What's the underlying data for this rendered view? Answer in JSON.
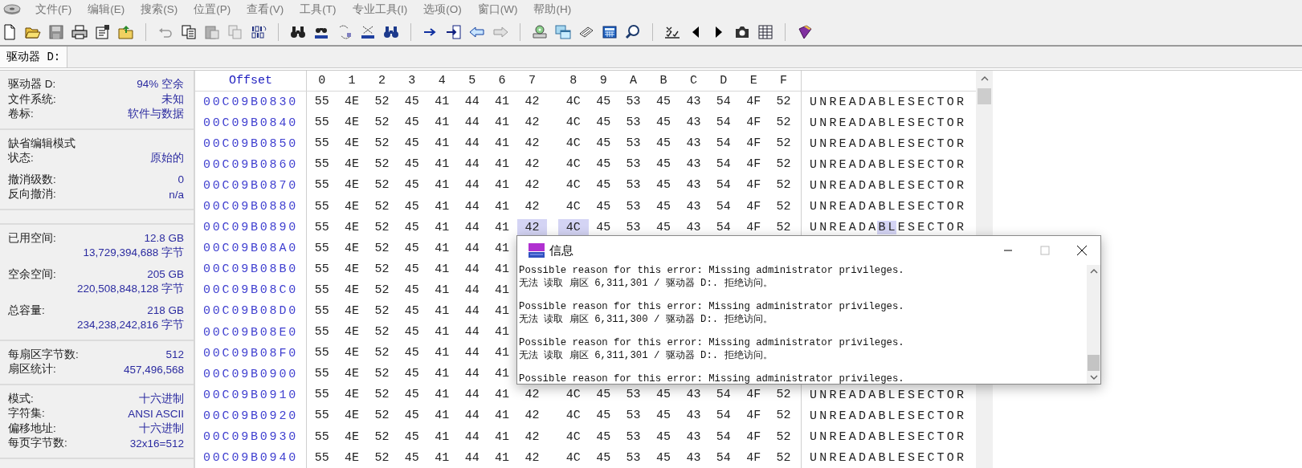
{
  "menu": [
    "文件(F)",
    "编辑(E)",
    "搜索(S)",
    "位置(P)",
    "查看(V)",
    "工具(T)",
    "专业工具(I)",
    "选项(O)",
    "窗口(W)",
    "帮助(H)"
  ],
  "tabs": [
    {
      "label": "驱动器 D:",
      "selected": true
    }
  ],
  "sidebar": {
    "sections": [
      {
        "groups": [
          [
            {
              "label": "驱动器 D:",
              "value": "94% 空余"
            },
            {
              "label": "文件系统:",
              "value": "未知"
            },
            {
              "label": "卷标:",
              "value": "软件与数据"
            }
          ]
        ]
      },
      {
        "groups": [
          [
            {
              "label": "缺省编辑模式"
            },
            {
              "label": "状态:",
              "value": "原始的"
            }
          ],
          [
            {
              "label": "撤消级数:",
              "value": "0"
            },
            {
              "label": "反向撤消:",
              "value": "n/a"
            }
          ]
        ],
        "blank_after": true
      },
      {
        "groups": [
          [
            {
              "label": "已用空间:",
              "value": "12.8 GB"
            },
            {
              "value": "13,729,394,688 字节"
            }
          ],
          [
            {
              "label": "空余空间:",
              "value": "205 GB"
            },
            {
              "value": "220,508,848,128 字节"
            }
          ],
          [
            {
              "label": "总容量:",
              "value": "218 GB"
            },
            {
              "value": "234,238,242,816 字节"
            }
          ]
        ]
      },
      {
        "groups": [
          [
            {
              "label": "每扇区字节数:",
              "value": "512"
            },
            {
              "label": "扇区统计:",
              "value": "457,496,568"
            }
          ]
        ]
      },
      {
        "groups": [
          [
            {
              "label": "模式:",
              "value": "十六进制"
            },
            {
              "label": "字符集:",
              "value": "ANSI ASCII"
            },
            {
              "label": "偏移地址:",
              "value": "十六进制"
            },
            {
              "label": "每页字节数:",
              "value": "32x16=512"
            }
          ]
        ]
      }
    ]
  },
  "hex": {
    "offset_header": "Offset",
    "columns": [
      "0",
      "1",
      "2",
      "3",
      "4",
      "5",
      "6",
      "7",
      "8",
      "9",
      "A",
      "B",
      "C",
      "D",
      "E",
      "F"
    ],
    "rows": [
      {
        "offset": "00C09B0830",
        "bytes": [
          {
            "hex": "55",
            "selected": false
          },
          {
            "hex": "4E",
            "selected": false
          },
          {
            "hex": "52",
            "selected": false
          },
          {
            "hex": "45",
            "selected": false
          },
          {
            "hex": "41",
            "selected": false
          },
          {
            "hex": "44",
            "selected": false
          },
          {
            "hex": "41",
            "selected": false
          },
          {
            "hex": "42",
            "selected": false
          },
          {
            "hex": "4C",
            "selected": false
          },
          {
            "hex": "45",
            "selected": false
          },
          {
            "hex": "53",
            "selected": false
          },
          {
            "hex": "45",
            "selected": false
          },
          {
            "hex": "43",
            "selected": false
          },
          {
            "hex": "54",
            "selected": false
          },
          {
            "hex": "4F",
            "selected": false
          },
          {
            "hex": "52",
            "selected": false
          }
        ],
        "ascii": "UNREADABLESECTOR"
      },
      {
        "offset": "00C09B0840",
        "bytes": [
          {
            "hex": "55",
            "selected": false
          },
          {
            "hex": "4E",
            "selected": false
          },
          {
            "hex": "52",
            "selected": false
          },
          {
            "hex": "45",
            "selected": false
          },
          {
            "hex": "41",
            "selected": false
          },
          {
            "hex": "44",
            "selected": false
          },
          {
            "hex": "41",
            "selected": false
          },
          {
            "hex": "42",
            "selected": false
          },
          {
            "hex": "4C",
            "selected": false
          },
          {
            "hex": "45",
            "selected": false
          },
          {
            "hex": "53",
            "selected": false
          },
          {
            "hex": "45",
            "selected": false
          },
          {
            "hex": "43",
            "selected": false
          },
          {
            "hex": "54",
            "selected": false
          },
          {
            "hex": "4F",
            "selected": false
          },
          {
            "hex": "52",
            "selected": false
          }
        ],
        "ascii": "UNREADABLESECTOR"
      },
      {
        "offset": "00C09B0850",
        "bytes": [
          {
            "hex": "55",
            "selected": false
          },
          {
            "hex": "4E",
            "selected": false
          },
          {
            "hex": "52",
            "selected": false
          },
          {
            "hex": "45",
            "selected": false
          },
          {
            "hex": "41",
            "selected": false
          },
          {
            "hex": "44",
            "selected": false
          },
          {
            "hex": "41",
            "selected": false
          },
          {
            "hex": "42",
            "selected": false
          },
          {
            "hex": "4C",
            "selected": false
          },
          {
            "hex": "45",
            "selected": false
          },
          {
            "hex": "53",
            "selected": false
          },
          {
            "hex": "45",
            "selected": false
          },
          {
            "hex": "43",
            "selected": false
          },
          {
            "hex": "54",
            "selected": false
          },
          {
            "hex": "4F",
            "selected": false
          },
          {
            "hex": "52",
            "selected": false
          }
        ],
        "ascii": "UNREADABLESECTOR"
      },
      {
        "offset": "00C09B0860",
        "bytes": [
          {
            "hex": "55",
            "selected": false
          },
          {
            "hex": "4E",
            "selected": false
          },
          {
            "hex": "52",
            "selected": false
          },
          {
            "hex": "45",
            "selected": false
          },
          {
            "hex": "41",
            "selected": false
          },
          {
            "hex": "44",
            "selected": false
          },
          {
            "hex": "41",
            "selected": false
          },
          {
            "hex": "42",
            "selected": false
          },
          {
            "hex": "4C",
            "selected": false
          },
          {
            "hex": "45",
            "selected": false
          },
          {
            "hex": "53",
            "selected": false
          },
          {
            "hex": "45",
            "selected": false
          },
          {
            "hex": "43",
            "selected": false
          },
          {
            "hex": "54",
            "selected": false
          },
          {
            "hex": "4F",
            "selected": false
          },
          {
            "hex": "52",
            "selected": false
          }
        ],
        "ascii": "UNREADABLESECTOR"
      },
      {
        "offset": "00C09B0870",
        "bytes": [
          {
            "hex": "55",
            "selected": false
          },
          {
            "hex": "4E",
            "selected": false
          },
          {
            "hex": "52",
            "selected": false
          },
          {
            "hex": "45",
            "selected": false
          },
          {
            "hex": "41",
            "selected": false
          },
          {
            "hex": "44",
            "selected": false
          },
          {
            "hex": "41",
            "selected": false
          },
          {
            "hex": "42",
            "selected": false
          },
          {
            "hex": "4C",
            "selected": false
          },
          {
            "hex": "45",
            "selected": false
          },
          {
            "hex": "53",
            "selected": false
          },
          {
            "hex": "45",
            "selected": false
          },
          {
            "hex": "43",
            "selected": false
          },
          {
            "hex": "54",
            "selected": false
          },
          {
            "hex": "4F",
            "selected": false
          },
          {
            "hex": "52",
            "selected": false
          }
        ],
        "ascii": "UNREADABLESECTOR"
      },
      {
        "offset": "00C09B0880",
        "bytes": [
          {
            "hex": "55",
            "selected": false
          },
          {
            "hex": "4E",
            "selected": false
          },
          {
            "hex": "52",
            "selected": false
          },
          {
            "hex": "45",
            "selected": false
          },
          {
            "hex": "41",
            "selected": false
          },
          {
            "hex": "44",
            "selected": false
          },
          {
            "hex": "41",
            "selected": false
          },
          {
            "hex": "42",
            "selected": false
          },
          {
            "hex": "4C",
            "selected": false
          },
          {
            "hex": "45",
            "selected": false
          },
          {
            "hex": "53",
            "selected": false
          },
          {
            "hex": "45",
            "selected": false
          },
          {
            "hex": "43",
            "selected": false
          },
          {
            "hex": "54",
            "selected": false
          },
          {
            "hex": "4F",
            "selected": false
          },
          {
            "hex": "52",
            "selected": false
          }
        ],
        "ascii": "UNREADABLESECTOR"
      },
      {
        "offset": "00C09B0890",
        "bytes": [
          {
            "hex": "55",
            "selected": false
          },
          {
            "hex": "4E",
            "selected": false
          },
          {
            "hex": "52",
            "selected": false
          },
          {
            "hex": "45",
            "selected": false
          },
          {
            "hex": "41",
            "selected": false
          },
          {
            "hex": "44",
            "selected": false
          },
          {
            "hex": "41",
            "selected": false
          },
          {
            "hex": "42",
            "selected": true
          },
          {
            "hex": "4C",
            "selected": true
          },
          {
            "hex": "45",
            "selected": false
          },
          {
            "hex": "53",
            "selected": false
          },
          {
            "hex": "45",
            "selected": false
          },
          {
            "hex": "43",
            "selected": false
          },
          {
            "hex": "54",
            "selected": false
          },
          {
            "hex": "4F",
            "selected": false
          },
          {
            "hex": "52",
            "selected": false
          }
        ],
        "ascii": "UNREADABLESECTOR"
      },
      {
        "offset": "00C09B08A0",
        "bytes": [
          {
            "hex": "55",
            "selected": false
          },
          {
            "hex": "4E",
            "selected": false
          },
          {
            "hex": "52",
            "selected": false
          },
          {
            "hex": "45",
            "selected": false
          },
          {
            "hex": "41",
            "selected": false
          },
          {
            "hex": "44",
            "selected": false
          },
          {
            "hex": "41",
            "selected": false
          }
        ]
      },
      {
        "offset": "00C09B08B0",
        "bytes": [
          {
            "hex": "55",
            "selected": false
          },
          {
            "hex": "4E",
            "selected": false
          },
          {
            "hex": "52",
            "selected": false
          },
          {
            "hex": "45",
            "selected": false
          },
          {
            "hex": "41",
            "selected": false
          },
          {
            "hex": "44",
            "selected": false
          },
          {
            "hex": "41",
            "selected": false
          }
        ]
      },
      {
        "offset": "00C09B08C0",
        "bytes": [
          {
            "hex": "55",
            "selected": false
          },
          {
            "hex": "4E",
            "selected": false
          },
          {
            "hex": "52",
            "selected": false
          },
          {
            "hex": "45",
            "selected": false
          },
          {
            "hex": "41",
            "selected": false
          },
          {
            "hex": "44",
            "selected": false
          },
          {
            "hex": "41",
            "selected": false
          }
        ]
      },
      {
        "offset": "00C09B08D0",
        "bytes": [
          {
            "hex": "55",
            "selected": false
          },
          {
            "hex": "4E",
            "selected": false
          },
          {
            "hex": "52",
            "selected": false
          },
          {
            "hex": "45",
            "selected": false
          },
          {
            "hex": "41",
            "selected": false
          },
          {
            "hex": "44",
            "selected": false
          },
          {
            "hex": "41",
            "selected": false
          }
        ]
      },
      {
        "offset": "00C09B08E0",
        "bytes": [
          {
            "hex": "55",
            "selected": false
          },
          {
            "hex": "4E",
            "selected": false
          },
          {
            "hex": "52",
            "selected": false
          },
          {
            "hex": "45",
            "selected": false
          },
          {
            "hex": "41",
            "selected": false
          },
          {
            "hex": "44",
            "selected": false
          },
          {
            "hex": "41",
            "selected": false
          }
        ]
      },
      {
        "offset": "00C09B08F0",
        "bytes": [
          {
            "hex": "55",
            "selected": false
          },
          {
            "hex": "4E",
            "selected": false
          },
          {
            "hex": "52",
            "selected": false
          },
          {
            "hex": "45",
            "selected": false
          },
          {
            "hex": "41",
            "selected": false
          },
          {
            "hex": "44",
            "selected": false
          },
          {
            "hex": "41",
            "selected": false
          }
        ]
      },
      {
        "offset": "00C09B0900",
        "bytes": [
          {
            "hex": "55",
            "selected": false
          },
          {
            "hex": "4E",
            "selected": false
          },
          {
            "hex": "52",
            "selected": false
          },
          {
            "hex": "45",
            "selected": false
          },
          {
            "hex": "41",
            "selected": false
          },
          {
            "hex": "44",
            "selected": false
          },
          {
            "hex": "41",
            "selected": false
          }
        ]
      },
      {
        "offset": "00C09B0910",
        "bytes": [
          {
            "hex": "55",
            "selected": false
          },
          {
            "hex": "4E",
            "selected": false
          },
          {
            "hex": "52",
            "selected": false
          },
          {
            "hex": "45",
            "selected": false
          },
          {
            "hex": "41",
            "selected": false
          },
          {
            "hex": "44",
            "selected": false
          },
          {
            "hex": "41",
            "selected": false
          },
          {
            "hex": "42",
            "selected": false
          },
          {
            "hex": "4C",
            "selected": false
          },
          {
            "hex": "45",
            "selected": false
          },
          {
            "hex": "53",
            "selected": false
          },
          {
            "hex": "45",
            "selected": false
          },
          {
            "hex": "43",
            "selected": false
          },
          {
            "hex": "54",
            "selected": false
          },
          {
            "hex": "4F",
            "selected": false
          },
          {
            "hex": "52",
            "selected": false
          }
        ],
        "ascii": "UNREADABLESECTOR"
      },
      {
        "offset": "00C09B0920",
        "bytes": [
          {
            "hex": "55",
            "selected": false
          },
          {
            "hex": "4E",
            "selected": false
          },
          {
            "hex": "52",
            "selected": false
          },
          {
            "hex": "45",
            "selected": false
          },
          {
            "hex": "41",
            "selected": false
          },
          {
            "hex": "44",
            "selected": false
          },
          {
            "hex": "41",
            "selected": false
          },
          {
            "hex": "42",
            "selected": false
          },
          {
            "hex": "4C",
            "selected": false
          },
          {
            "hex": "45",
            "selected": false
          },
          {
            "hex": "53",
            "selected": false
          },
          {
            "hex": "45",
            "selected": false
          },
          {
            "hex": "43",
            "selected": false
          },
          {
            "hex": "54",
            "selected": false
          },
          {
            "hex": "4F",
            "selected": false
          },
          {
            "hex": "52",
            "selected": false
          }
        ],
        "ascii": "UNREADABLESECTOR"
      },
      {
        "offset": "00C09B0930",
        "bytes": [
          {
            "hex": "55",
            "selected": false
          },
          {
            "hex": "4E",
            "selected": false
          },
          {
            "hex": "52",
            "selected": false
          },
          {
            "hex": "45",
            "selected": false
          },
          {
            "hex": "41",
            "selected": false
          },
          {
            "hex": "44",
            "selected": false
          },
          {
            "hex": "41",
            "selected": false
          },
          {
            "hex": "42",
            "selected": false
          },
          {
            "hex": "4C",
            "selected": false
          },
          {
            "hex": "45",
            "selected": false
          },
          {
            "hex": "53",
            "selected": false
          },
          {
            "hex": "45",
            "selected": false
          },
          {
            "hex": "43",
            "selected": false
          },
          {
            "hex": "54",
            "selected": false
          },
          {
            "hex": "4F",
            "selected": false
          },
          {
            "hex": "52",
            "selected": false
          }
        ],
        "ascii": "UNREADABLESECTOR"
      },
      {
        "offset": "00C09B0940",
        "bytes": [
          {
            "hex": "55",
            "selected": false
          },
          {
            "hex": "4E",
            "selected": false
          },
          {
            "hex": "52",
            "selected": false
          },
          {
            "hex": "45",
            "selected": false
          },
          {
            "hex": "41",
            "selected": false
          },
          {
            "hex": "44",
            "selected": false
          },
          {
            "hex": "41",
            "selected": false
          },
          {
            "hex": "42",
            "selected": false
          },
          {
            "hex": "4C",
            "selected": false
          },
          {
            "hex": "45",
            "selected": false
          },
          {
            "hex": "53",
            "selected": false
          },
          {
            "hex": "45",
            "selected": false
          },
          {
            "hex": "43",
            "selected": false
          },
          {
            "hex": "54",
            "selected": false
          },
          {
            "hex": "4F",
            "selected": false
          },
          {
            "hex": "52",
            "selected": false
          }
        ],
        "ascii": "UNREADABLESECTOR"
      }
    ]
  },
  "dialog": {
    "title": "信息",
    "messages": [
      {
        "reason": "Possible reason for this error: Missing administrator privileges.",
        "error": "无法 读取 扇区 6,311,301 / 驱动器 D:. 拒绝访问。"
      },
      {
        "reason": "Possible reason for this error: Missing administrator privileges.",
        "error": "无法 读取 扇区 6,311,300 / 驱动器 D:. 拒绝访问。"
      },
      {
        "reason": "Possible reason for this error: Missing administrator privileges.",
        "error": "无法 读取 扇区 6,311,301 / 驱动器 D:. 拒绝访问。"
      },
      {
        "reason": "Possible reason for this error: Missing administrator privileges."
      }
    ]
  }
}
